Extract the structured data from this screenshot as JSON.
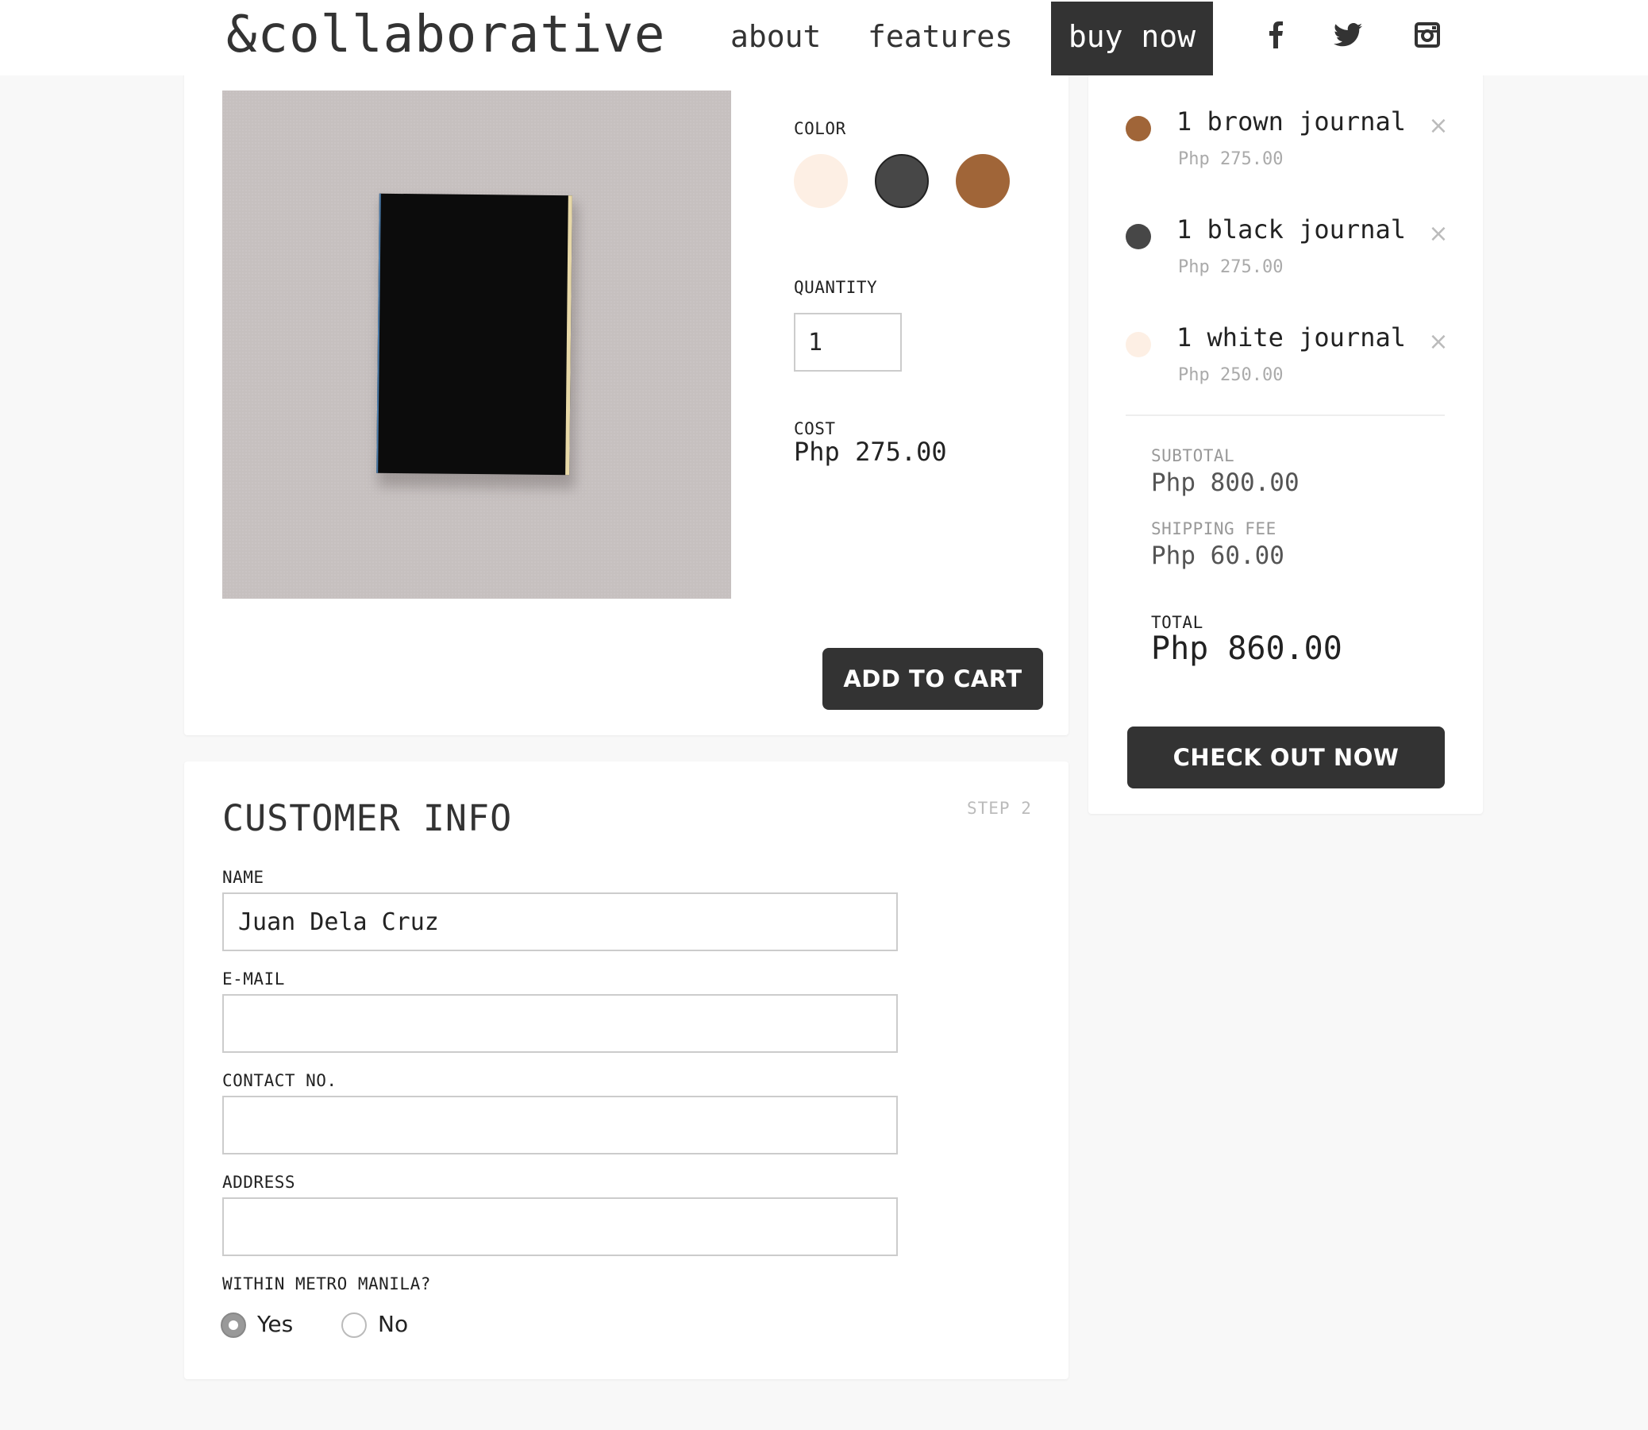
{
  "header": {
    "brand": "&collaborative",
    "nav": {
      "about": "about",
      "features": "features",
      "buy_now": "buy now"
    },
    "social": [
      "facebook-icon",
      "twitter-icon",
      "instagram-icon"
    ]
  },
  "product": {
    "color_label": "COLOR",
    "colors": [
      {
        "name": "white",
        "hex": "#fdefe4"
      },
      {
        "name": "black",
        "hex": "#474747"
      },
      {
        "name": "brown",
        "hex": "#a06538"
      }
    ],
    "selected_color": "black",
    "quantity_label": "QUANTITY",
    "quantity_value": "1",
    "cost_label": "COST",
    "cost_value": "Php 275.00",
    "add_to_cart_label": "ADD TO CART"
  },
  "customer": {
    "title": "CUSTOMER INFO",
    "step": "STEP 2",
    "name_label": "NAME",
    "name_value": "Juan Dela Cruz",
    "email_label": "E-MAIL",
    "email_value": "",
    "contact_label": "CONTACT NO.",
    "contact_value": "",
    "address_label": "ADDRESS",
    "address_value": "",
    "metro_label": "WITHIN METRO MANILA?",
    "metro_options": {
      "yes": "Yes",
      "no": "No"
    },
    "metro_selected": "Yes"
  },
  "cart": {
    "items": [
      {
        "name": "1 brown journal",
        "price": "Php 275.00",
        "color": "#a06538"
      },
      {
        "name": "1 black journal",
        "price": "Php 275.00",
        "color": "#474747"
      },
      {
        "name": "1 white journal",
        "price": "Php 250.00",
        "color": "#fdefe4"
      }
    ],
    "remove_glyph": "×",
    "subtotal_label": "SUBTOTAL",
    "subtotal_value": "Php 800.00",
    "shipping_label": "SHIPPING FEE",
    "shipping_value": "Php 60.00",
    "total_label": "TOTAL",
    "total_value": "Php 860.00",
    "checkout_label": "CHECK OUT NOW"
  }
}
